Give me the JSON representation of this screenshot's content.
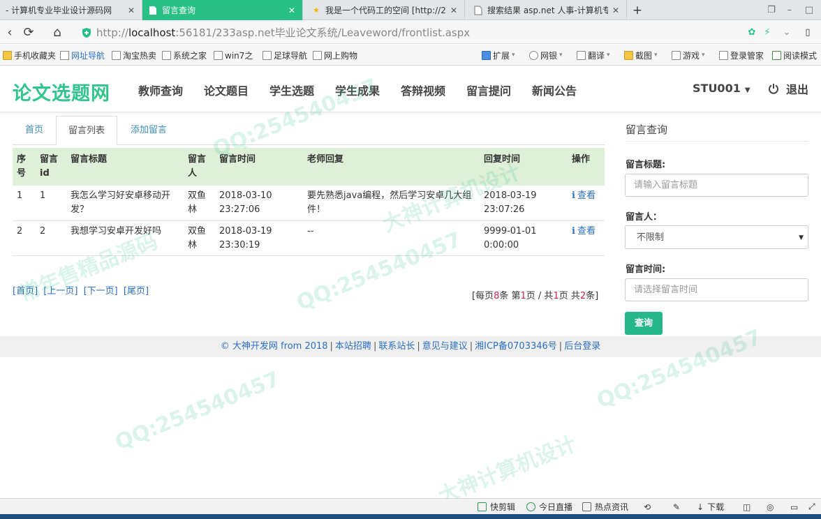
{
  "browser": {
    "tabs": [
      {
        "title": "- 计算机专业毕业设计源码网",
        "active": false
      },
      {
        "title": "留言查询",
        "active": true
      },
      {
        "title": "我是一个代码工的空间 [http://2",
        "active": false
      },
      {
        "title": "搜索结果 asp.net 人事-计算机专",
        "active": false
      }
    ],
    "new_tab": "+",
    "address": {
      "scheme": "http://",
      "host": "localhost",
      "rest": ":56181/233asp.net毕业论文系统/Leaveword/frontlist.aspx"
    },
    "bookmarks": [
      "手机收藏夹",
      "网址导航",
      "淘宝热卖",
      "系统之家",
      "win7之",
      "足球导航",
      "网上购物"
    ],
    "bookmark_tools": [
      "扩展",
      "网银",
      "翻译",
      "截图",
      "游戏",
      "登录管家",
      "阅读模式"
    ]
  },
  "site": {
    "logo": "论文选题网",
    "nav": [
      "教师查询",
      "论文题目",
      "学生选题",
      "学生成果",
      "答辩视频",
      "留言提问",
      "新闻公告"
    ],
    "user": "STU001",
    "logout": "退出"
  },
  "subtabs": [
    "首页",
    "留言列表",
    "添加留言"
  ],
  "table": {
    "headers": [
      "序号",
      "留言id",
      "留言标题",
      "留言人",
      "留言时间",
      "老师回复",
      "回复时间",
      "操作"
    ],
    "rows": [
      {
        "no": "1",
        "id": "1",
        "title": "我怎么学习好安卓移动开发？",
        "author": "双鱼林",
        "time": "2018-03-10 23:27:06",
        "reply": "要先熟悉java编程，然后学习安卓几大组件！",
        "reply_time": "2018-03-19 23:07:26",
        "action": "查看"
      },
      {
        "no": "2",
        "id": "2",
        "title": "我想学习安卓开发好吗",
        "author": "双鱼林",
        "time": "2018-03-19 23:30:19",
        "reply": "--",
        "reply_time": "9999-01-01 0:00:00",
        "action": "查看"
      }
    ]
  },
  "pager": {
    "links": [
      "[首页]",
      "[上一页]",
      "[下一页]",
      "[尾页]"
    ],
    "info_prefix": "[每页",
    "per_page": "8",
    "info_mid1": "条 第",
    "page": "1",
    "info_mid2": "页 / 共",
    "pages": "1",
    "info_mid3": "页 共",
    "total": "2",
    "info_suffix": "条]"
  },
  "sidebar": {
    "title": "留言查询",
    "title_label": "留言标题:",
    "title_placeholder": "请输入留言标题",
    "author_label": "留言人：",
    "author_selected": "不限制",
    "time_label": "留言时间:",
    "time_placeholder": "请选择留言时间",
    "query_button": "查询"
  },
  "footer": [
    "© 大神开发网 from 2018",
    "本站招聘",
    "联系站长",
    "意见与建议",
    "湘ICP备0703346号",
    "后台登录"
  ],
  "statusbar": [
    "快剪辑",
    "今日直播",
    "热点资讯",
    "下载"
  ],
  "watermark": [
    "QQ:254540457",
    "常年售精品源码",
    "大神计算机设计"
  ],
  "colors": {
    "brand": "#31c48d",
    "tab_active": "#27c186",
    "table_header": "#dff0d8",
    "link": "#2a6fc4",
    "button": "#25b78a"
  }
}
